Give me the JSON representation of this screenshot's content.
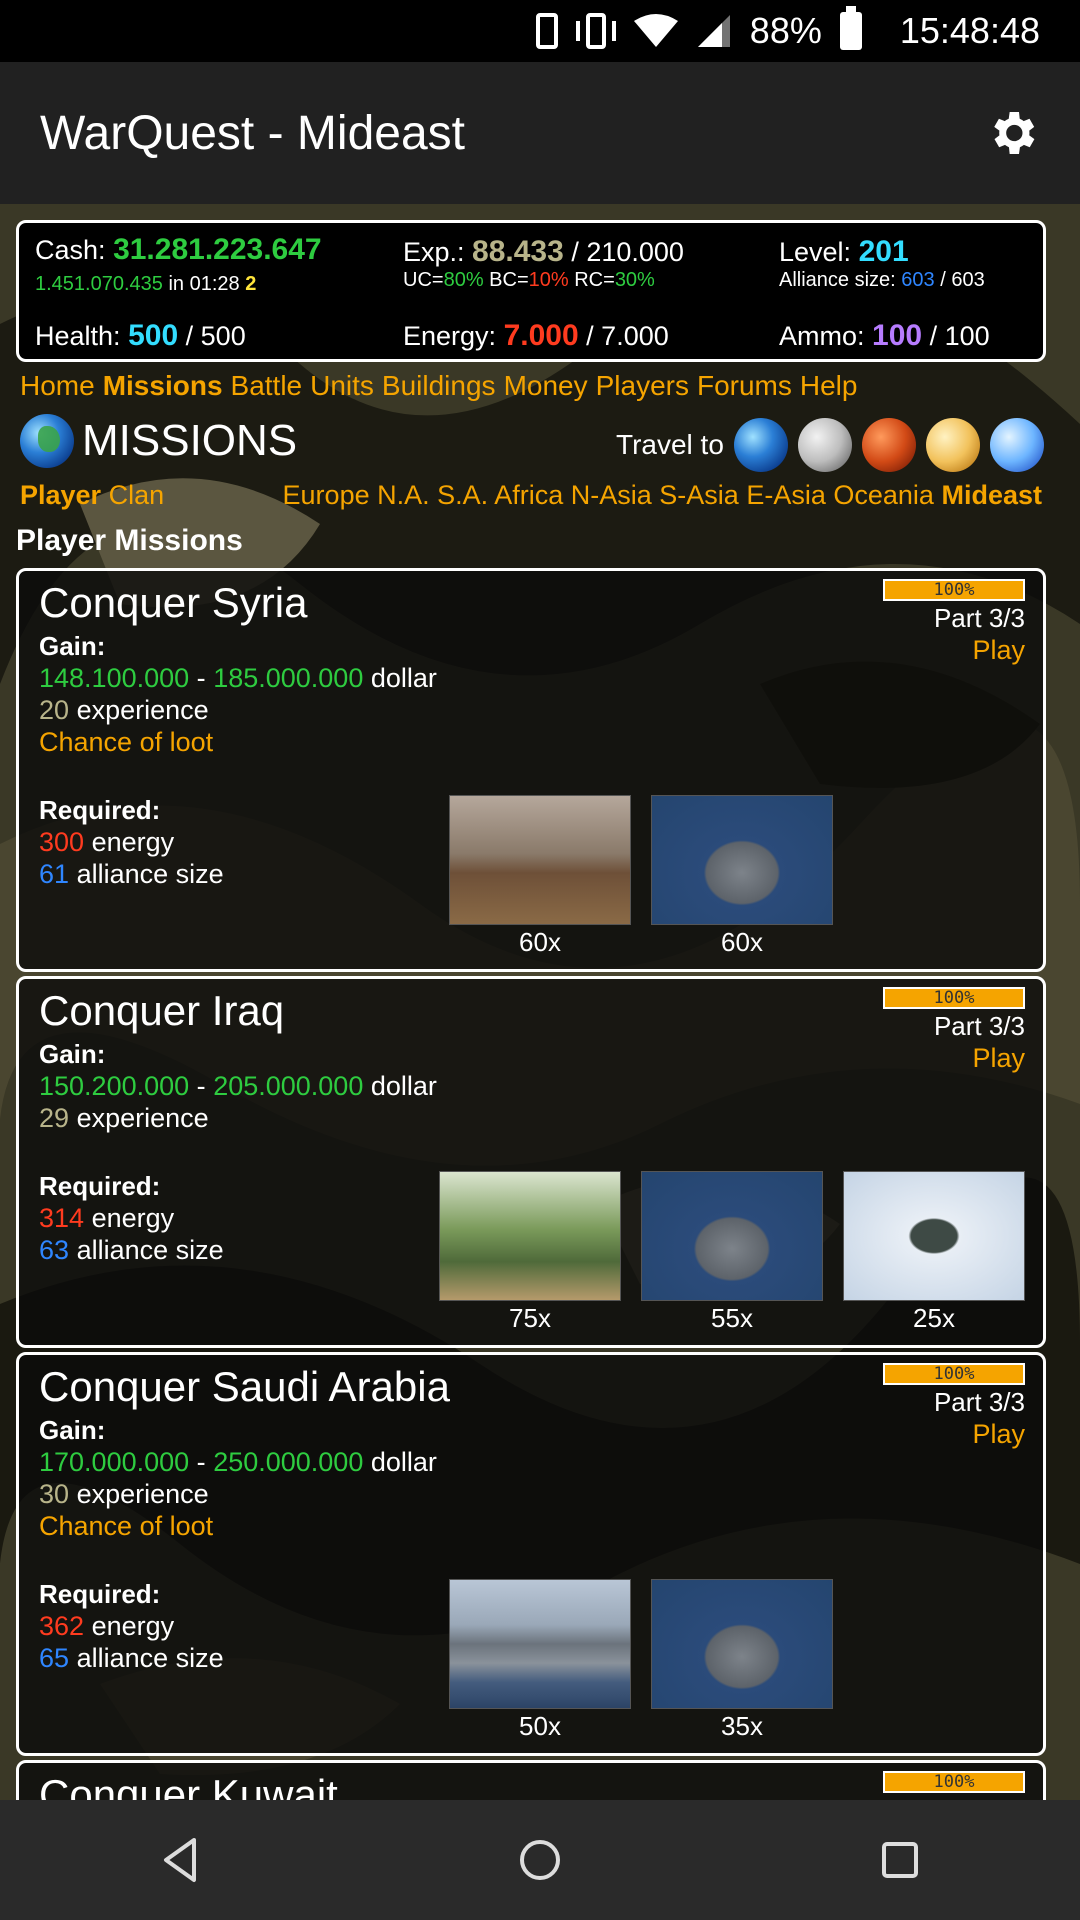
{
  "status": {
    "battery": "88%",
    "time": "15:48:48"
  },
  "app": {
    "title": "WarQuest - Mideast"
  },
  "stats": {
    "cash_label": "Cash:",
    "cash": "31.281.223.647",
    "income": "1.451.070.435",
    "income_in": "in 01:28",
    "income_count": "2",
    "exp_label": "Exp.:",
    "exp": "88.433",
    "exp_max": "/ 210.000",
    "uc_label": "UC=",
    "uc": "80%",
    "bc_label": "BC=",
    "bc": "10%",
    "rc_label": "RC=",
    "rc": "30%",
    "level_label": "Level:",
    "level": "201",
    "alliance_label": "Alliance size:",
    "alliance": "603",
    "alliance_max": "/ 603",
    "health_label": "Health:",
    "health": "500",
    "health_max": "/ 500",
    "energy_label": "Energy:",
    "energy": "7.000",
    "energy_max": "/ 7.000",
    "ammo_label": "Ammo:",
    "ammo": "100",
    "ammo_max": "/ 100"
  },
  "nav": [
    "Home",
    "Missions",
    "Battle",
    "Units",
    "Buildings",
    "Money",
    "Players",
    "Forums",
    "Help"
  ],
  "missions_title": "MISSIONS",
  "travel_label": "Travel to",
  "sub_left": [
    "Player",
    "Clan"
  ],
  "regions": [
    "Europe",
    "N.A.",
    "S.A.",
    "Africa",
    "N-Asia",
    "S-Asia",
    "E-Asia",
    "Oceania",
    "Mideast"
  ],
  "section_title": "Player Missions",
  "labels": {
    "gain": "Gain:",
    "required": "Required:",
    "dollar": "dollar",
    "experience": "experience",
    "energy": "energy",
    "alliance": "alliance size",
    "loot": "Chance of loot",
    "play": "Play",
    "dash": "-"
  },
  "missions": [
    {
      "name": "Conquer Syria",
      "progress": "100%",
      "part": "Part 3/3",
      "gain_min": "148.100.000",
      "gain_max": "185.000.000",
      "exp": "20",
      "loot": true,
      "req_energy": "300",
      "req_alliance": "61",
      "units": [
        {
          "img": "artillery",
          "count": "60x"
        },
        {
          "img": "ship",
          "count": "60x"
        }
      ]
    },
    {
      "name": "Conquer Iraq",
      "progress": "100%",
      "part": "Part 3/3",
      "gain_min": "150.200.000",
      "gain_max": "205.000.000",
      "exp": "29",
      "loot": false,
      "req_energy": "314",
      "req_alliance": "63",
      "units": [
        {
          "img": "tank",
          "count": "75x"
        },
        {
          "img": "ship",
          "count": "55x"
        },
        {
          "img": "bomber",
          "count": "25x"
        }
      ]
    },
    {
      "name": "Conquer Saudi Arabia",
      "progress": "100%",
      "part": "Part 3/3",
      "gain_min": "170.000.000",
      "gain_max": "250.000.000",
      "exp": "30",
      "loot": true,
      "req_energy": "362",
      "req_alliance": "65",
      "units": [
        {
          "img": "carrier",
          "count": "50x"
        },
        {
          "img": "ship",
          "count": "35x"
        }
      ]
    },
    {
      "name": "Conquer Kuwait",
      "progress": "100%"
    }
  ]
}
